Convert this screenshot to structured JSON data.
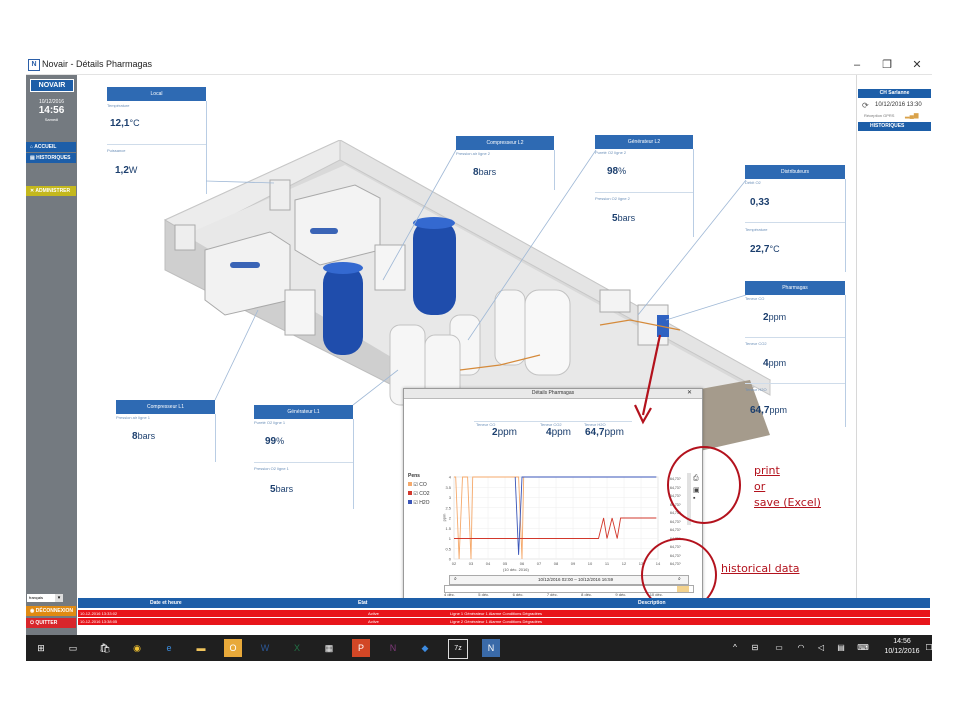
{
  "window": {
    "title": "Novair - Détails Pharmagas",
    "app_icon": "N"
  },
  "sidebar": {
    "logo": "NOVAIR",
    "date": "10/12/2016",
    "time": "14:56",
    "day": "Samedi",
    "buttons": [
      {
        "label": "ACCUEIL",
        "icon": "home-icon"
      },
      {
        "label": "HISTORIQUES",
        "icon": "history-icon"
      },
      {
        "label": "ADMINISTRER",
        "icon": "tools-icon"
      }
    ],
    "language": "français",
    "disconnect": "DÉCONNEXION",
    "quit": "QUITTER"
  },
  "cards": {
    "local": {
      "title": "Local",
      "temp_label": "Température",
      "temp_value": "12,1",
      "temp_unit": "°C",
      "power_label": "Puissance",
      "power_value": "1,2",
      "power_unit": "W"
    },
    "comp_l2": {
      "title": "Compresseur L2",
      "sub": "Pression air ligne 2",
      "value": "8",
      "unit": "bars"
    },
    "gen_l2": {
      "title": "Générateur L2",
      "sub1": "Pureté O2 ligne 2",
      "value1": "98",
      "unit1": "%",
      "sub2": "Pression O2 ligne 2",
      "value2": "5",
      "unit2": "bars"
    },
    "dist": {
      "title": "Distributeurs",
      "sub1": "Débit O2",
      "value1": "0,33",
      "sub2": "Température",
      "value2": "22,7",
      "unit2": "°C"
    },
    "pharmagas": {
      "title": "Pharmagas",
      "sub1": "Teneur CO",
      "value1": "2",
      "unit1": "ppm",
      "sub2": "Teneur CO2",
      "value2": "4",
      "unit2": "ppm",
      "sub3": "Teneur H2O",
      "value3": "64,7",
      "unit3": "ppm"
    },
    "comp_l1": {
      "title": "Compresseur L1",
      "sub": "Pression air ligne 1",
      "value": "8",
      "unit": "bars"
    },
    "gen_l1": {
      "title": "Générateur L1",
      "sub1": "Pureté O2 ligne 1",
      "value1": "99",
      "unit1": "%",
      "sub2": "Pression O2 ligne 1",
      "value2": "5",
      "unit2": "bars"
    }
  },
  "right_panel": {
    "site": "CH Sarlanne",
    "datetime": "10/12/2016 13:30",
    "signal": "Réception GPRS",
    "button": "HISTORIQUES"
  },
  "popup": {
    "title": "Détails Pharmagas",
    "readings": [
      {
        "label": "Teneur CO",
        "value": "2",
        "unit": "ppm"
      },
      {
        "label": "Teneur CO2",
        "value": "4",
        "unit": "ppm"
      },
      {
        "label": "Teneur H2O",
        "value": "64,7",
        "unit": "ppm"
      }
    ],
    "legend_title": "Pens",
    "ylabel": "ppm",
    "xlabel": "(10 déc. 2016)",
    "range_text": "10/12/2016 02:00 – 10/12/2016 16:59",
    "scroll_ticks": [
      "4 déc.",
      "5 déc.",
      "6 déc.",
      "7 déc.",
      "8 déc.",
      "9 déc.",
      "10 déc."
    ],
    "side_values": [
      "64,73?",
      "64,73?",
      "64,73?",
      "64,73?",
      "64,73?",
      "64,73?",
      "64,73?",
      "64,73?",
      "64,73?",
      "64,73?",
      "64,73?"
    ]
  },
  "chart_data": {
    "type": "line",
    "title": "",
    "xlabel": "(10 déc. 2016)",
    "ylabel": "ppm",
    "x_ticks": [
      "02",
      "03",
      "04",
      "05",
      "06",
      "07",
      "08",
      "09",
      "10",
      "11",
      "12",
      "13",
      "14"
    ],
    "y_ticks": [
      0,
      0.5,
      1,
      1.5,
      2,
      2.5,
      3,
      3.5,
      4
    ],
    "ylim": [
      0,
      4
    ],
    "grid": true,
    "legend": "left",
    "series": [
      {
        "name": "CO",
        "color": "#f5a96b",
        "points": [
          [
            2.0,
            4
          ],
          [
            2.1,
            4
          ],
          [
            2.3,
            0
          ],
          [
            2.5,
            4
          ],
          [
            2.8,
            4
          ],
          [
            3.0,
            0
          ],
          [
            3.1,
            4
          ],
          [
            5.8,
            4
          ],
          [
            6.0,
            0
          ],
          [
            6.1,
            4
          ],
          [
            13.9,
            4
          ]
        ]
      },
      {
        "name": "CO2",
        "color": "#d2382c",
        "points": [
          [
            2.0,
            1
          ],
          [
            10.5,
            1
          ],
          [
            10.8,
            2
          ],
          [
            11.0,
            1
          ],
          [
            11.3,
            2
          ],
          [
            11.6,
            1
          ],
          [
            11.8,
            2
          ],
          [
            13.9,
            2
          ]
        ]
      },
      {
        "name": "H2O",
        "color": "#3a55b8",
        "points": [
          [
            5.6,
            4
          ],
          [
            5.8,
            0.2
          ],
          [
            6.0,
            4
          ],
          [
            13.9,
            4
          ]
        ]
      }
    ]
  },
  "alarms": {
    "headers": [
      "Date et heure",
      "Etat",
      "Description"
    ],
    "rows": [
      {
        "date": "10-12-2016 13:33:02",
        "state": "Active",
        "desc": "Ligne 1 Générateur 1 Alarme Conditions Dégradées"
      },
      {
        "date": "10-12-2016 13:38:05",
        "state": "Active",
        "desc": "Ligne 2 Générateur 1 Alarme Conditions Dégradées"
      }
    ]
  },
  "annotations": {
    "print_line1": "print",
    "print_line2": "or",
    "print_line3": "save (Excel)",
    "historical": "historical data"
  },
  "taskbar": {
    "time": "14:56",
    "date": "10/12/2016"
  }
}
